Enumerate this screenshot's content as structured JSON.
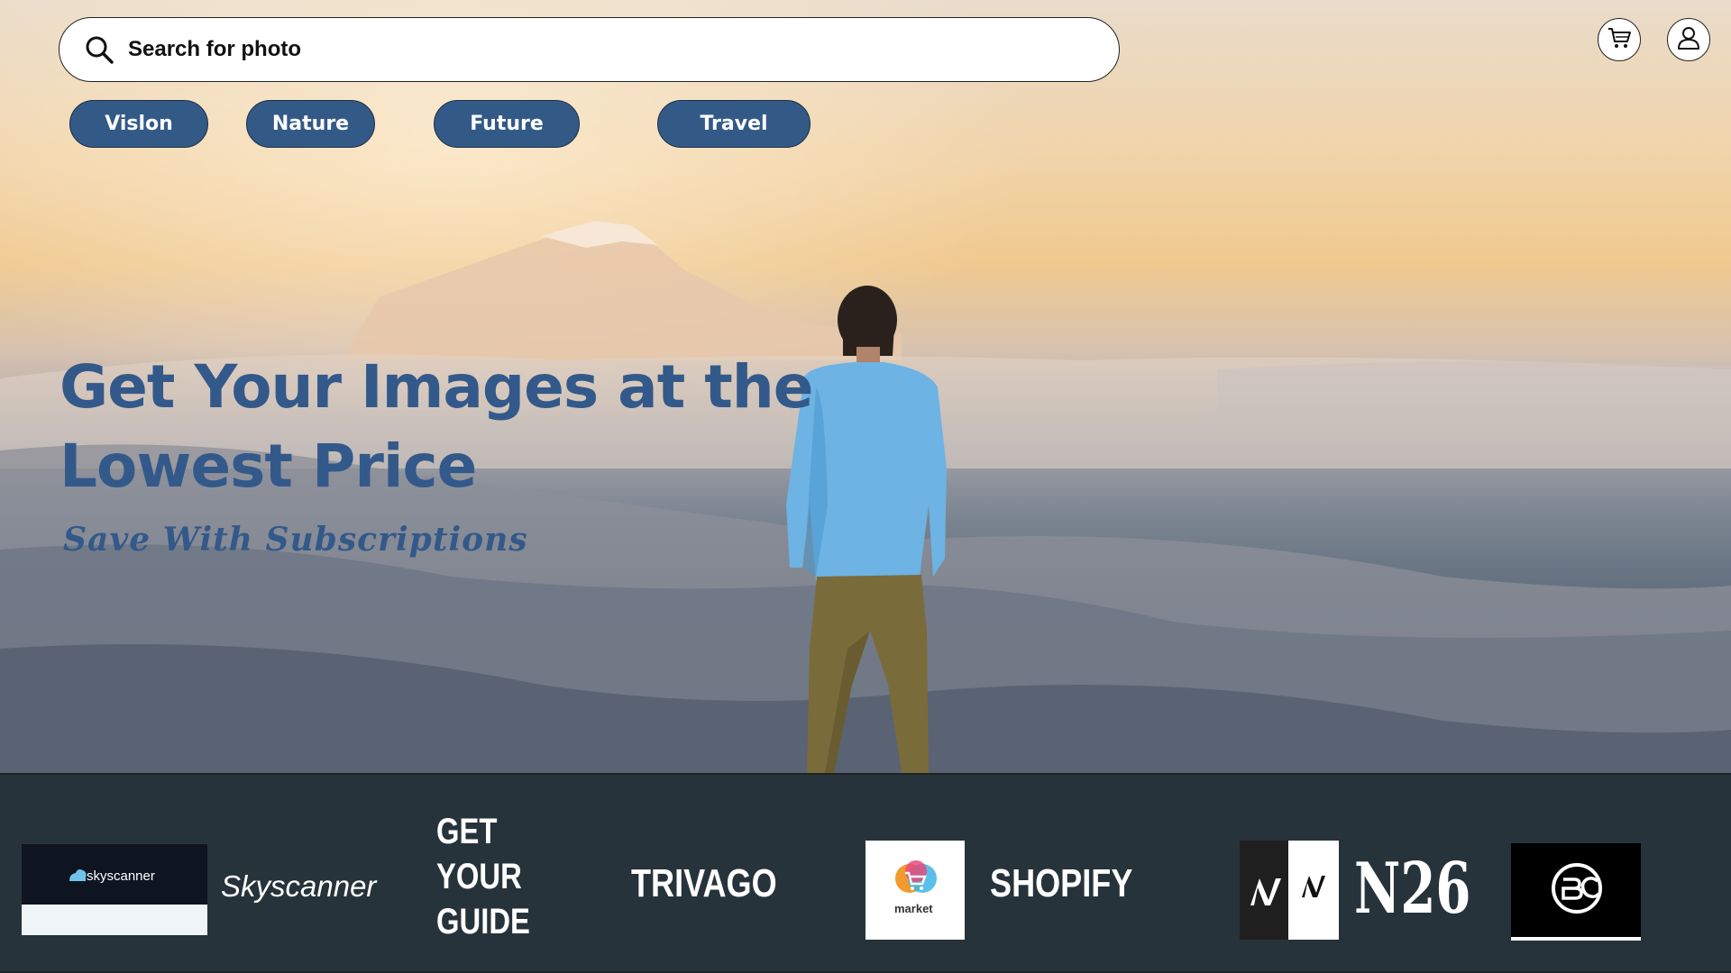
{
  "search": {
    "placeholder": "Search for photo"
  },
  "header": {
    "cart_icon": "cart-icon",
    "account_icon": "user-icon"
  },
  "categories": [
    {
      "label": "Vislon"
    },
    {
      "label": "Nature"
    },
    {
      "label": "Future"
    },
    {
      "label": "Travel"
    }
  ],
  "hero": {
    "headline_line1": "Get Your Images at the",
    "headline_line2": "Lowest Price",
    "tagline": "Save With Subscriptions"
  },
  "partners": {
    "skyscanner_logo_text": "skyscanner",
    "skyscanner_name": "Skyscanner",
    "getyourguide_line1": "GET",
    "getyourguide_line2": "YOUR",
    "getyourguide_line3": "GUIDE",
    "trivago": "TRIVAGO",
    "market_logo_text": "market",
    "shopify": "SHOPIFY",
    "n26": "N26"
  },
  "colors": {
    "accent": "#335a87",
    "strip_background": "#27333a"
  }
}
